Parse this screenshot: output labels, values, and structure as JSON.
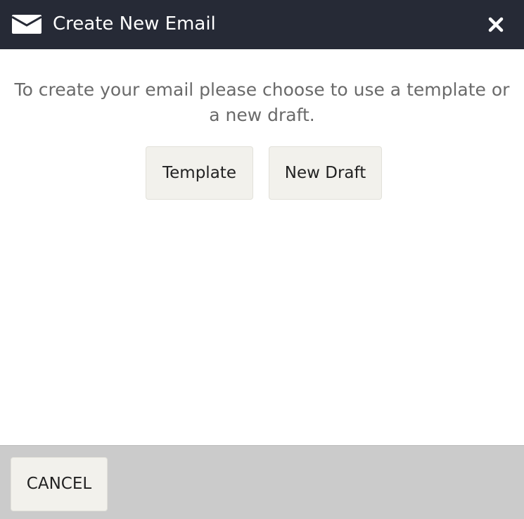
{
  "dialog": {
    "title": "Create New Email",
    "message": "To create your email please choose to use a template or a new draft.",
    "header_icon": "envelope-icon",
    "close_icon": "close-icon"
  },
  "choices": {
    "template_label": "Template",
    "new_draft_label": "New Draft"
  },
  "footer": {
    "cancel_label": "CANCEL"
  },
  "colors": {
    "header_bg": "#262a36",
    "footer_bg": "#cbcbcb",
    "button_bg": "#f2f1ec",
    "message_text": "#6a6a6a"
  }
}
